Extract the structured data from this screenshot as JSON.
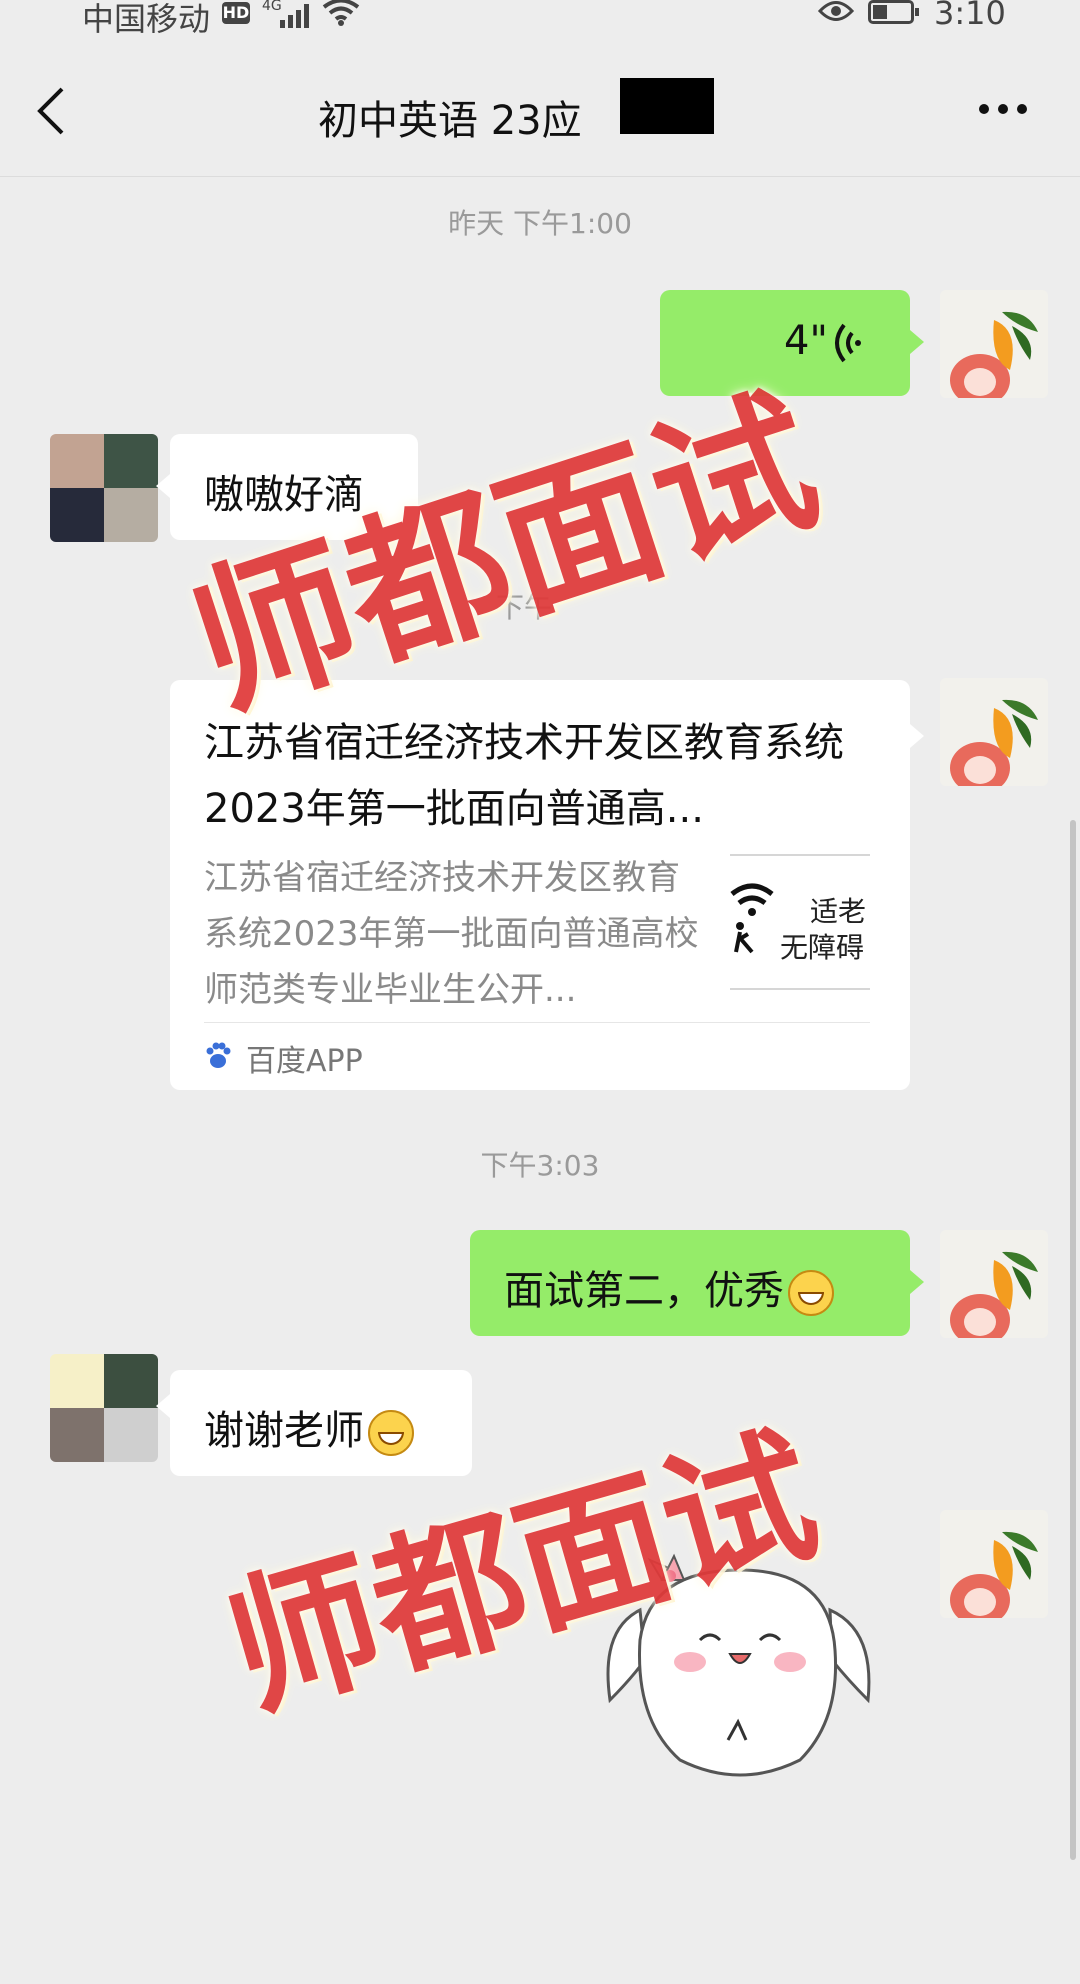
{
  "status_bar": {
    "carrier": "中国移动",
    "hd_badge": "HD",
    "network": "4G",
    "time": "3:10"
  },
  "header": {
    "title": "初中英语 23应",
    "back_icon": "chevron-left-icon",
    "more_icon": "more-dots-icon"
  },
  "chat": {
    "timestamp_1": "昨天 下午1:00",
    "voice_message": {
      "duration": "4\"",
      "icon": "voice-wave-icon"
    },
    "msg_1": "嗷嗷好滴",
    "timestamp_2_partial": "下午",
    "link_card": {
      "title": "江苏省宿迁经济技术开发区教育系统2023年第一批面向普通高...",
      "description": "江苏省宿迁经济技术开发区教育系统2023年第一批面向普通高校师范类专业毕业生公开...",
      "thumb_line_1": "适老",
      "thumb_line_2": "无障碍",
      "source": "百度APP"
    },
    "timestamp_3": "下午3:03",
    "msg_2": "面试第二，优秀",
    "msg_3": "谢谢老师"
  },
  "watermark": {
    "text": "师都面试",
    "color": "#e03a3a"
  },
  "colors": {
    "background": "#ededed",
    "sent_bubble": "#95ec69",
    "received_bubble": "#ffffff"
  }
}
